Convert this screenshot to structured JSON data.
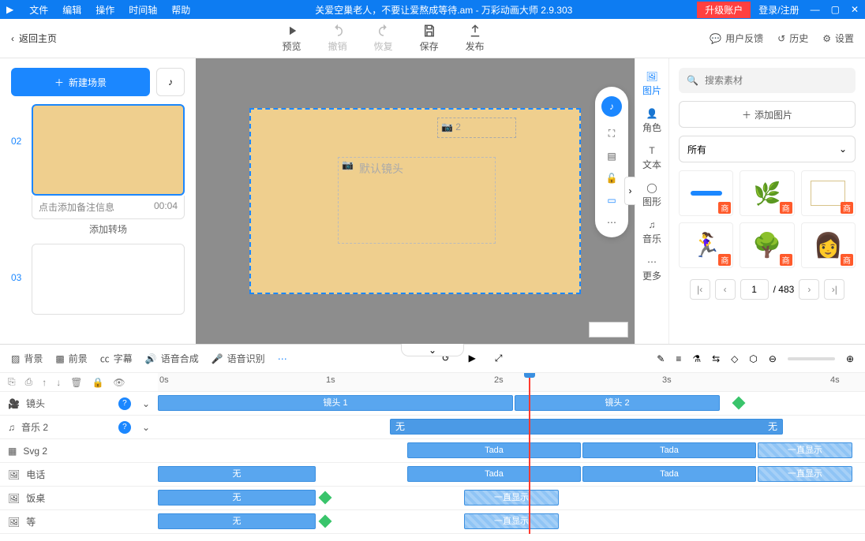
{
  "titlebar": {
    "menus": [
      "文件",
      "编辑",
      "操作",
      "时间轴",
      "帮助"
    ],
    "title": "关爱空巢老人，不要让爱熬成等待.am - 万彩动画大师 2.9.303",
    "upgrade": "升级账户",
    "login": "登录/注册"
  },
  "toolbar": {
    "back": "返回主页",
    "preview": "预览",
    "undo": "撤销",
    "redo": "恢复",
    "save": "保存",
    "publish": "发布",
    "feedback": "用户反馈",
    "history": "历史",
    "settings": "设置"
  },
  "scenes": {
    "new": "新建场景",
    "items": [
      {
        "num": "02",
        "note": "点击添加备注信息",
        "dur": "00:04"
      },
      {
        "num": "03"
      }
    ],
    "add_trans": "添加转场"
  },
  "canvas": {
    "default_cam": "默认镜头",
    "cam2": "2"
  },
  "cats": {
    "image": "图片",
    "role": "角色",
    "text": "文本",
    "shape": "图形",
    "music": "音乐",
    "more": "更多"
  },
  "assets": {
    "search": "搜索素材",
    "add": "添加图片",
    "filter": "所有",
    "badge": "商",
    "page": "1",
    "total": "/ 483"
  },
  "tl": {
    "tools": {
      "bg": "背景",
      "fg": "前景",
      "sub": "字幕",
      "tts": "语音合成",
      "asr": "语音识别"
    },
    "ruler": [
      "0s",
      "1s",
      "2s",
      "3s",
      "4s"
    ],
    "tracks": [
      {
        "name": "镜头",
        "help": true
      },
      {
        "name": "音乐 2",
        "help": true
      },
      {
        "name": "Svg 2"
      },
      {
        "name": "电话"
      },
      {
        "name": "饭桌"
      },
      {
        "name": "等"
      }
    ],
    "clips": {
      "cam1": "镜头 1",
      "cam2": "镜头 2",
      "none": "无",
      "tada": "Tada",
      "always": "一直显示"
    }
  }
}
